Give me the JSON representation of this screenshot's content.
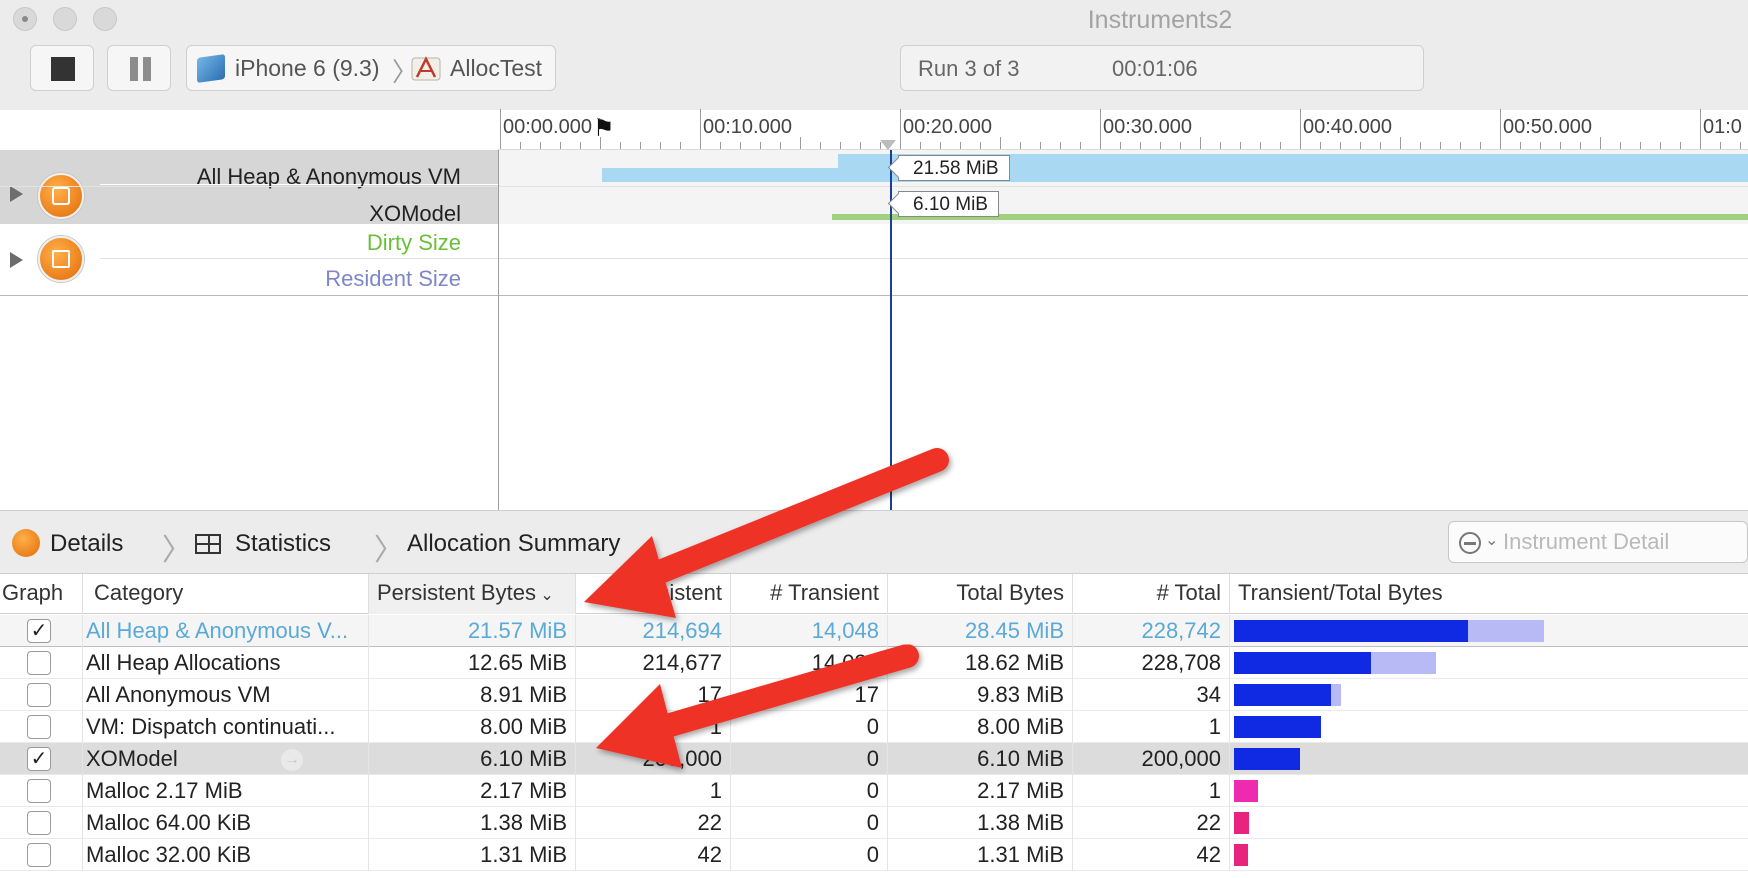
{
  "window": {
    "title": "Instruments2"
  },
  "toolbar": {
    "device": "iPhone 6 (9.3)",
    "app": "AllocTest",
    "run_label": "Run 3 of 3",
    "run_time": "00:01:06"
  },
  "ruler": {
    "labels": [
      "00:00.000",
      "00:10.000",
      "00:20.000",
      "00:30.000",
      "00:40.000",
      "00:50.000",
      "01:0"
    ]
  },
  "tracks": {
    "allocations": {
      "labels": [
        "All Heap & Anonymous VM",
        "XOModel"
      ]
    },
    "vm_tracker": {
      "labels": [
        "Dirty Size",
        "Resident Size"
      ]
    },
    "flags": {
      "heap": "21.58 MiB",
      "xomodel": "6.10 MiB"
    },
    "colors": {
      "heap": "#a9d8f3",
      "xomodel": "#9fd17e",
      "dirty": "#6abf3a",
      "resident": "#7e86c8",
      "playhead": "#1c3f94"
    }
  },
  "nav": {
    "details": "Details",
    "statistics": "Statistics",
    "summary": "Allocation Summary",
    "search_placeholder": "Instrument Detail"
  },
  "table": {
    "columns": [
      "Graph",
      "Category",
      "Persistent Bytes",
      "# Persistent",
      "# Transient",
      "Total Bytes",
      "# Total",
      "Transient/Total Bytes"
    ],
    "rows": [
      {
        "checked": true,
        "category": "All Heap & Anonymous V...",
        "persistent_bytes": "21.57 MiB",
        "persistent": "214,694",
        "transient": "14,048",
        "total_bytes": "28.45 MiB",
        "total": "228,742",
        "bar_transient": 0.755,
        "bar_total": 1.0,
        "bar_color": "#1029e3"
      },
      {
        "checked": false,
        "category": "All Heap Allocations",
        "persistent_bytes": "12.65 MiB",
        "persistent": "214,677",
        "transient": "14,031",
        "total_bytes": "18.62 MiB",
        "total": "228,708",
        "bar_transient": 0.443,
        "bar_total": 0.653,
        "bar_color": "#1029e3"
      },
      {
        "checked": false,
        "category": "All Anonymous VM",
        "persistent_bytes": "8.91 MiB",
        "persistent": "17",
        "transient": "17",
        "total_bytes": "9.83 MiB",
        "total": "34",
        "bar_transient": 0.313,
        "bar_total": 0.345,
        "bar_color": "#1029e3"
      },
      {
        "checked": false,
        "category": "VM: Dispatch continuati...",
        "persistent_bytes": "8.00 MiB",
        "persistent": "1",
        "transient": "0",
        "total_bytes": "8.00 MiB",
        "total": "1",
        "bar_transient": 0.281,
        "bar_total": 0.281,
        "bar_color": "#1029e3"
      },
      {
        "checked": true,
        "category": "XOModel",
        "persistent_bytes": "6.10 MiB",
        "persistent": "200,000",
        "transient": "0",
        "total_bytes": "6.10 MiB",
        "total": "200,000",
        "bar_transient": 0.214,
        "bar_total": 0.214,
        "bar_color": "#1029e3"
      },
      {
        "checked": false,
        "category": "Malloc 2.17 MiB",
        "persistent_bytes": "2.17 MiB",
        "persistent": "1",
        "transient": "0",
        "total_bytes": "2.17 MiB",
        "total": "1",
        "bar_transient": 0.076,
        "bar_total": 0.076,
        "bar_color": "#ee2ab0"
      },
      {
        "checked": false,
        "category": "Malloc 64.00 KiB",
        "persistent_bytes": "1.38 MiB",
        "persistent": "22",
        "transient": "0",
        "total_bytes": "1.38 MiB",
        "total": "22",
        "bar_transient": 0.048,
        "bar_total": 0.048,
        "bar_color": "#e8247e"
      },
      {
        "checked": false,
        "category": "Malloc 32.00 KiB",
        "persistent_bytes": "1.31 MiB",
        "persistent": "42",
        "transient": "0",
        "total_bytes": "1.31 MiB",
        "total": "42",
        "bar_transient": 0.046,
        "bar_total": 0.046,
        "bar_color": "#e8247e"
      }
    ]
  },
  "annotations": {
    "arrow_color": "#ef3327"
  }
}
